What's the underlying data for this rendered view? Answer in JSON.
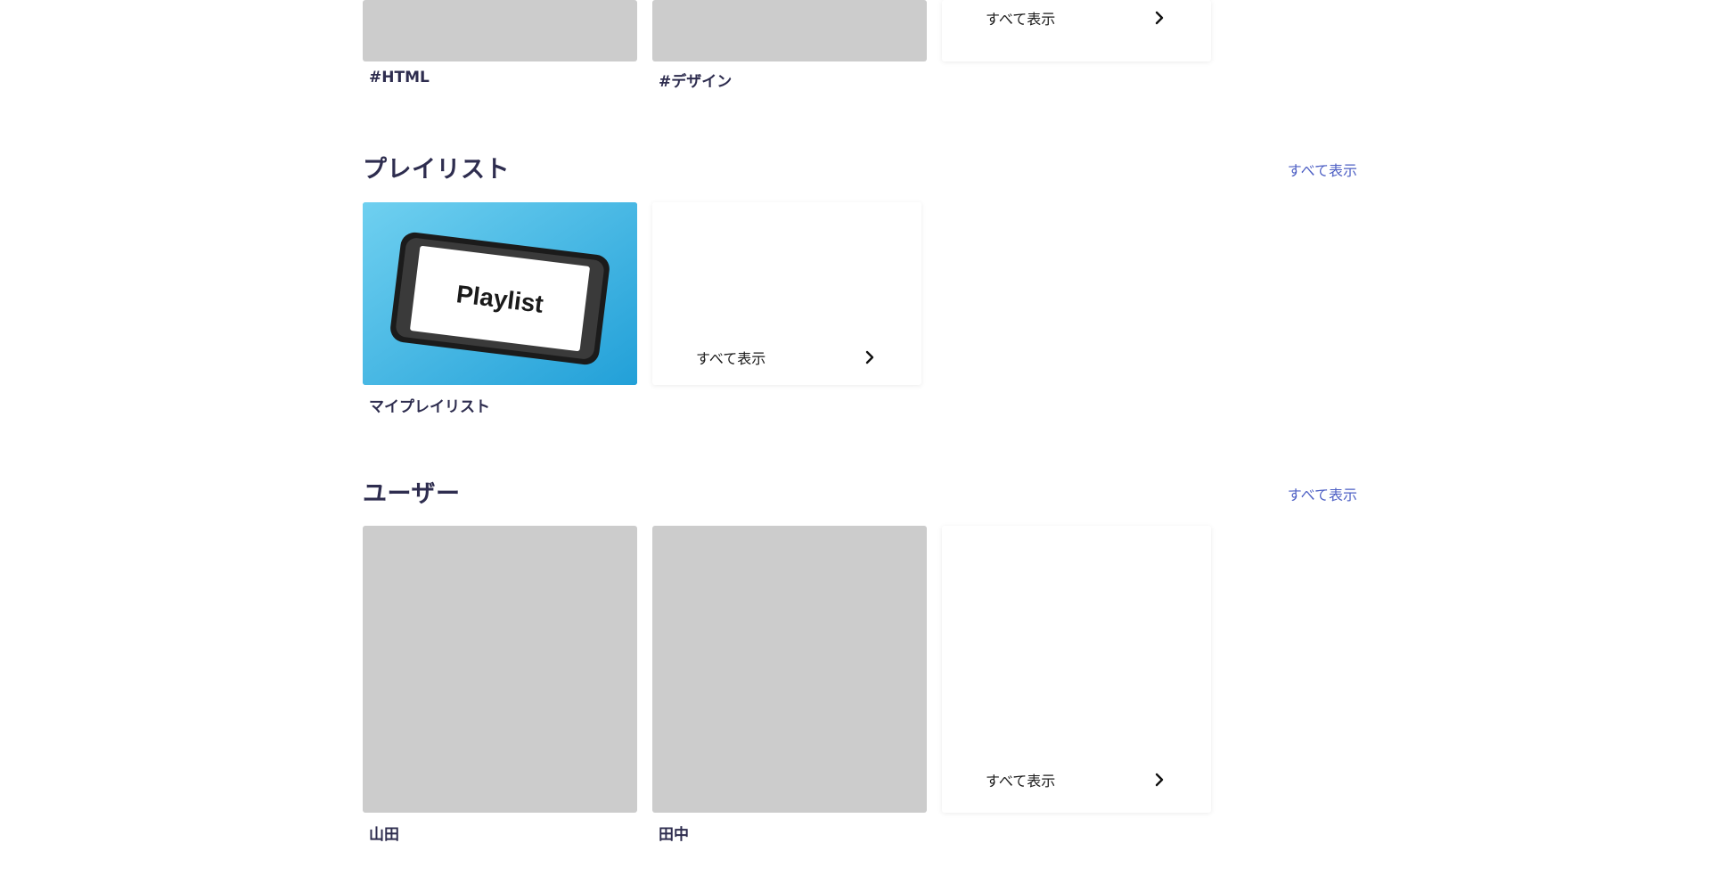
{
  "tags": {
    "cards": [
      {
        "label": "#HTML"
      },
      {
        "label": "#デザイン"
      }
    ],
    "more_label": "すべて表示"
  },
  "playlists": {
    "title": "プレイリスト",
    "see_all": "すべて表示",
    "cards": [
      {
        "label": "マイプレイリスト",
        "image_text": "Playlist"
      }
    ],
    "more_label": "すべて表示"
  },
  "users": {
    "title": "ユーザー",
    "see_all": "すべて表示",
    "cards": [
      {
        "label": "山田"
      },
      {
        "label": "田中"
      }
    ],
    "more_label": "すべて表示"
  }
}
